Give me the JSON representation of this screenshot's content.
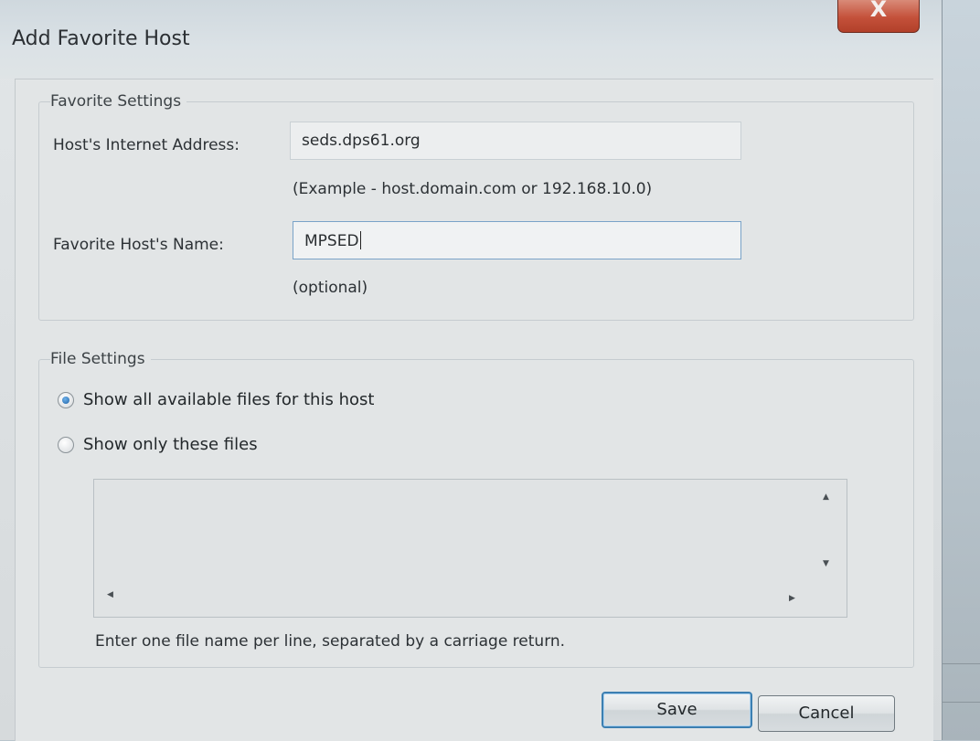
{
  "window": {
    "title": "Add Favorite Host",
    "close_glyph": "X"
  },
  "favorite_settings": {
    "group_label": "Favorite Settings",
    "address_label": "Host's Internet Address:",
    "address_value": "seds.dps61.org",
    "address_hint": "(Example - host.domain.com or 192.168.10.0)",
    "name_label": "Favorite Host's Name:",
    "name_value": "MPSED",
    "name_hint": "(optional)"
  },
  "file_settings": {
    "group_label": "File Settings",
    "options": [
      {
        "label": "Show all available files for this host",
        "checked": true
      },
      {
        "label": "Show only these files",
        "checked": false
      }
    ],
    "files_text": "",
    "instructions": "Enter one file name per line, separated by a carriage return."
  },
  "buttons": {
    "save": "Save",
    "cancel": "Cancel"
  },
  "colors": {
    "close_button": "#c4513a",
    "default_button_border": "#3c7fb1",
    "radio_selected": "#1f63a8"
  },
  "icons": {
    "close": "close-icon",
    "radio_selected": "radio-selected-icon",
    "radio_unselected": "radio-unselected-icon",
    "scroll_up": "scroll-up-arrow-icon",
    "scroll_down": "scroll-down-arrow-icon",
    "scroll_left": "scroll-left-arrow-icon",
    "scroll_right": "scroll-right-arrow-icon"
  }
}
